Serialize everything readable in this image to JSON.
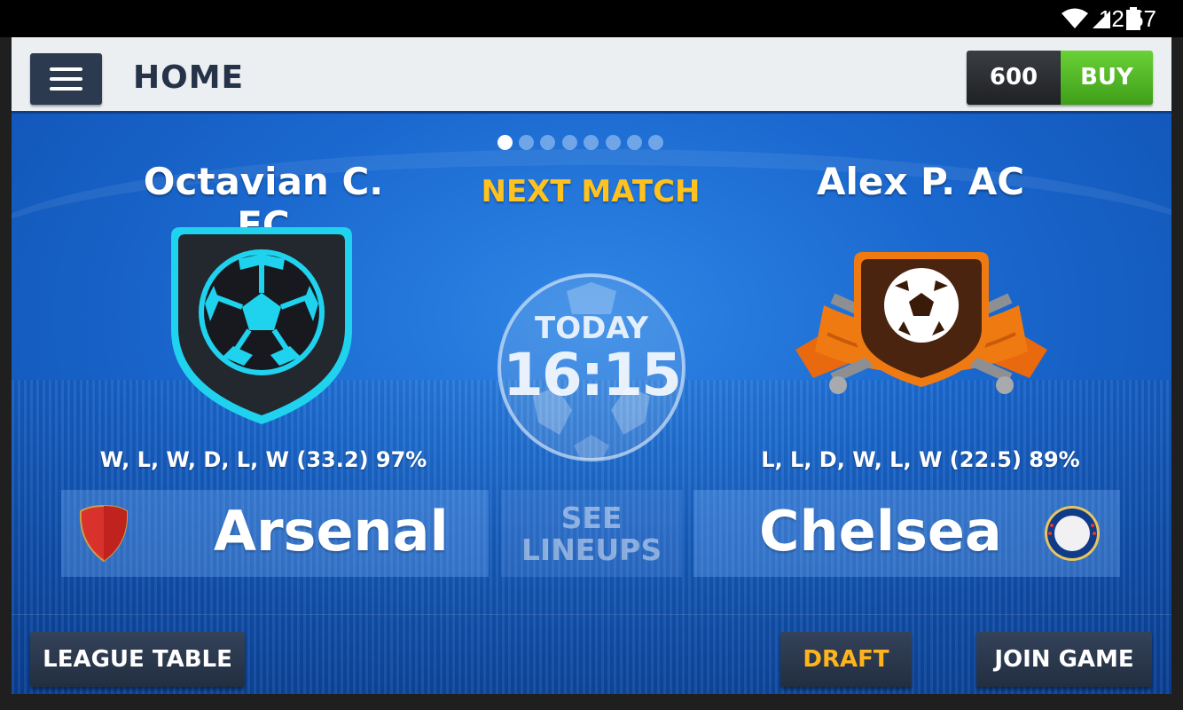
{
  "status_bar": {
    "time": "12:57",
    "icons": [
      "wifi-icon",
      "signal-icon",
      "battery-icon"
    ]
  },
  "header": {
    "title": "HOME",
    "coins": "600",
    "buy_label": "BUY"
  },
  "carousel": {
    "page_count": 8,
    "active_index": 0
  },
  "match": {
    "label": "NEXT MATCH",
    "day": "TODAY",
    "time": "16:15",
    "lineups_label_1": "SEE",
    "lineups_label_2": "LINEUPS"
  },
  "home": {
    "manager": "Octavian C. FC",
    "form": "W, L, W, D, L, W (33.2) 97%",
    "club": "Arsenal",
    "crest_icon": "soccer-ball-shield-icon",
    "club_badge_icon": "arsenal-shield-icon"
  },
  "away": {
    "manager": "Alex P. AC",
    "form": "L, L, D, W, L, W (22.5) 89%",
    "club": "Chelsea",
    "crest_icon": "soccer-ball-swords-crest-icon",
    "club_badge_icon": "chelsea-badge-icon"
  },
  "actions": {
    "league_table": "LEAGUE TABLE",
    "draft": "DRAFT",
    "join_game": "JOIN GAME"
  },
  "colors": {
    "accent_yellow": "#ffc21e",
    "buy_green": "#4cae22",
    "header_navy": "#2b3a4e",
    "home_crest": "#1fd3ef",
    "away_crest": "#f07a12"
  }
}
